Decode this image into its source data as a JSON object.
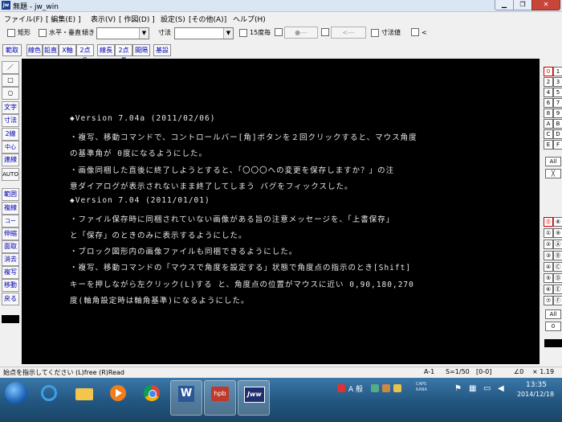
{
  "window": {
    "title": "無題 - jw_win",
    "app_icon": "jw"
  },
  "menubar": [
    "ファイル(F)",
    "[ 編集(E) ]",
    "表示(V)",
    "[ 作図(D) ]",
    "設定(S)",
    "[その他(A)]",
    "ヘルプ(H)"
  ],
  "toolbar1": {
    "chk_shape": "矩形",
    "chk_hv": "水平・垂直",
    "slope_label": "傾き",
    "dim_label": "寸法",
    "chk_15": "15度毎",
    "chk_dim_value": "寸法値",
    "chk_lt": "<",
    "btn_dots": "●---",
    "btn_arrows": "<---"
  },
  "toolbar2": [
    "範取",
    "線色",
    "鉛直",
    "X軸",
    "2点角",
    "線長",
    "2点長",
    "間隔",
    "基設"
  ],
  "left_tools": [
    "／",
    "□",
    "○",
    "文字",
    "寸法",
    "2線",
    "中心線",
    "連線",
    "AUTO",
    "範囲",
    "複線",
    "コーナー",
    "伸縮",
    "面取",
    "消去",
    "複写",
    "移動",
    "戻る"
  ],
  "right_panel": {
    "top": [
      "0",
      "1",
      "2",
      "3",
      "4",
      "5",
      "6",
      "7",
      "8",
      "9",
      "A",
      "B",
      "C",
      "D",
      "E",
      "F"
    ],
    "top_all": "All",
    "top_x": "╳",
    "bottom": [
      "⓪",
      "⑧",
      "①",
      "⑨",
      "②",
      "Ⓐ",
      "③",
      "Ⓑ",
      "④",
      "Ⓒ",
      "⑤",
      "Ⓓ",
      "⑥",
      "Ⓔ",
      "⑦",
      "Ⓕ"
    ],
    "bottom_all": "All",
    "bottom_zero": "0"
  },
  "canvas_text": [
    "◆Version 7.04a (2011/02/06)",
    "・複写、移動コマンドで、コントロールバー[角]ボタンを２回クリックすると、マウス角度",
    "の基準角が 0度になるようにした。",
    "・画像同梱した直後に終了しようとすると、「〇〇〇への変更を保存しますか？」の注",
    "意ダイアログが表示されないまま終了してしまう バグをフィックスした。",
    "◆Version 7.04 (2011/01/01)",
    "・ファイル保存時に同梱されていない画像がある旨の注意メッセージを、「上書保存」",
    "と「保存」のときのみに表示するようにした。",
    "・ブロック図形内の画像ファイルも同梱できるようにした。",
    "・複写、移動コマンドの「マウスで角度を設定する」状態で角度点の指示のとき[Shift]",
    "キーを押しながら左クリック(L)する と、角度点の位置がマウスに近い 0,90,180,270",
    "度(軸角設定時は軸角基準)になるようにした。"
  ],
  "statusbar": {
    "message": "始点を指示してください (L)free (R)Read",
    "layer": "A-1",
    "scale": "S=1/50",
    "group": "[0-0]",
    "angle": "∠0",
    "zoom": "× 1.19"
  },
  "taskbar": {
    "icons": [
      "start-orb-icon",
      "ie-icon",
      "folder-icon",
      "media-player-icon",
      "chrome-icon",
      "word-icon",
      "hpb-icon",
      "jw-icon"
    ],
    "hpb_label": "hpb",
    "jw_label": "Jww",
    "word_label": "W",
    "ime": "A 般",
    "caps": "CAPS KANA",
    "time": "13:35",
    "date": "2014/12/18"
  }
}
